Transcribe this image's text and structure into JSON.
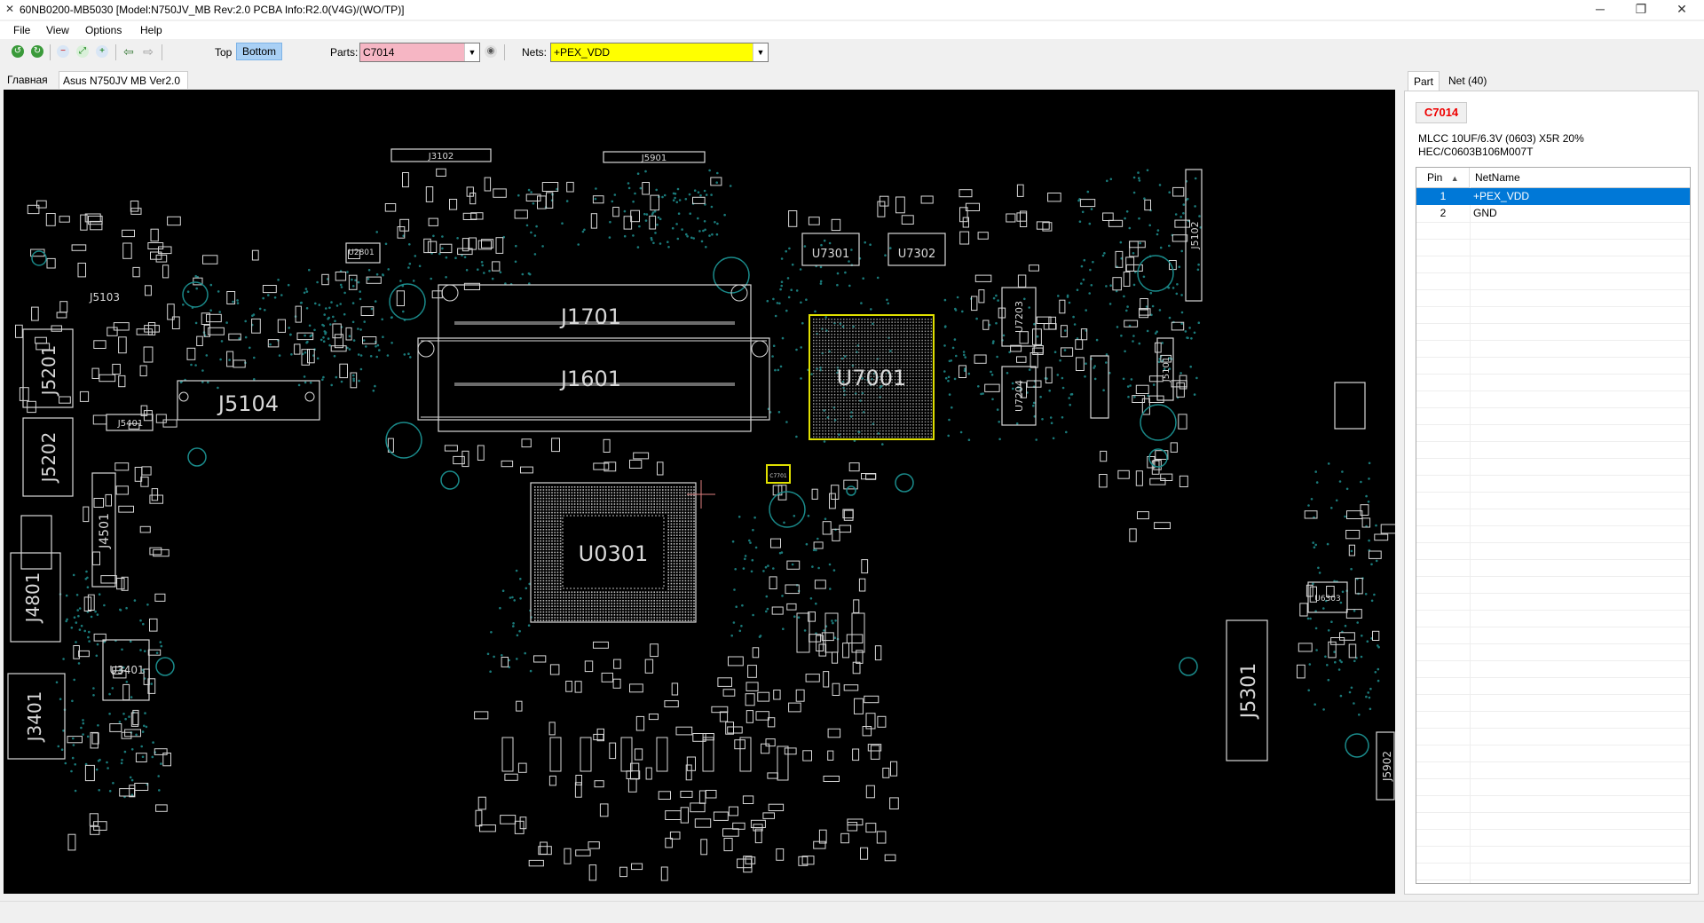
{
  "window": {
    "title": "60NB0200-MB5030 [Model:N750JV_MB Rev:2.0 PCBA Info:R2.0(V4G)/(WO/TP)]",
    "minimize": "─",
    "maximize": "❐",
    "close": "✕"
  },
  "menu": {
    "items": [
      "File",
      "View",
      "Options",
      "Help"
    ]
  },
  "toolbar": {
    "top_label": "Top",
    "bottom_label": "Bottom",
    "parts_label": "Parts:",
    "parts_value": "C7014",
    "nets_label": "Nets:",
    "nets_value": "+PEX_VDD",
    "colors": {
      "parts_bg": "#f6b6c4",
      "nets_bg": "#ffff00"
    }
  },
  "tabs": [
    "Главная",
    "Asus N750JV MB Ver2.0"
  ],
  "board": {
    "labels": {
      "j3102": "J3102",
      "j5901": "J5901",
      "j5103": "J5103",
      "j1701": "J1701",
      "j1601": "J1601",
      "j5104": "J5104",
      "u7001": "U7001",
      "u7301": "U7301",
      "u7302": "U7302",
      "u0301": "U0301",
      "j5201": "J5201",
      "j5202": "J5202",
      "j4501": "J4501",
      "j4801": "J4801",
      "j3401": "J3401",
      "u3401": "U3401",
      "j5301": "J5301",
      "j5902": "J5902",
      "u7203": "U7203",
      "u7204": "U7204",
      "u2801": "U2801",
      "j5101": "J5101",
      "j5401": "J5401",
      "j5102": "J5102",
      "u6303": "U6303",
      "c7701": "C7701"
    }
  },
  "right_panel": {
    "tabs": [
      "Part",
      "Net (40)"
    ],
    "part_name": "C7014",
    "part_desc_line1": "MLCC 10UF/6.3V (0603) X5R 20%",
    "part_desc_line2": "HEC/C0603B106M007T",
    "table": {
      "headers": [
        "Pin",
        "NetName"
      ],
      "rows": [
        {
          "pin": "1",
          "net": "+PEX_VDD"
        },
        {
          "pin": "2",
          "net": "GND"
        }
      ]
    }
  }
}
